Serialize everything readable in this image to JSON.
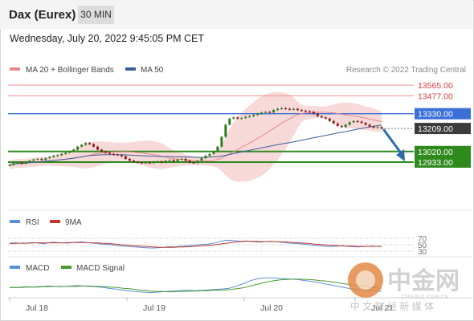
{
  "header": {
    "instrument": "Dax (Eurex)",
    "timeframe": "30 MIN",
    "datetime": "Wednesday, July 20, 2022 9:45:05 PM CET"
  },
  "colors": {
    "bb_band": "#f0b9b9",
    "ma20": "#e8888a",
    "ma50": "#3b5e9c",
    "resistance": "#f09090",
    "pivot": "#3a6fd8",
    "support": "#2f8a1d",
    "bull_candle": "#2e7d1a",
    "bear_candle": "#8b1a1a",
    "arrow": "#2e6ca8",
    "rsi": "#5b8fd8",
    "rsi_ma": "#c0392b",
    "macd": "#5b8fd8",
    "macd_signal": "#4a9a2b"
  },
  "chart_data": [
    {
      "type": "candlestick",
      "legend": {
        "ma20_label": "MA 20 + Bollinger Bands",
        "ma50_label": "MA 50",
        "credit": "Research © 2022 Trading Central"
      },
      "levels": [
        {
          "label": "13565.00",
          "value": 13565,
          "kind": "resistance"
        },
        {
          "label": "13477.00",
          "value": 13477,
          "kind": "resistance"
        },
        {
          "label": "13330.00",
          "value": 13330,
          "kind": "pivot"
        },
        {
          "label": "13209.00",
          "value": 13209,
          "kind": "last"
        },
        {
          "label": "13020.00",
          "value": 13020,
          "kind": "support"
        },
        {
          "label": "12933.00",
          "value": 12933,
          "kind": "support"
        }
      ],
      "x_labels": [
        "Jul 18",
        "Jul 19",
        "Jul 20",
        "Jul 21"
      ],
      "closes": [
        12910,
        12925,
        12930,
        12920,
        12935,
        12945,
        12955,
        12960,
        12950,
        12965,
        12975,
        12985,
        12990,
        13000,
        13010,
        13020,
        13035,
        13060,
        13075,
        13090,
        13080,
        13060,
        13035,
        13020,
        13010,
        13000,
        12995,
        12990,
        12980,
        12960,
        12945,
        12935,
        12930,
        12925,
        12930,
        12925,
        12935,
        12940,
        12930,
        12945,
        12950,
        12940,
        12955,
        12960,
        12945,
        12930,
        12925,
        12945,
        12965,
        12985,
        13000,
        13020,
        13060,
        13140,
        13240,
        13290,
        13300,
        13290,
        13295,
        13305,
        13310,
        13320,
        13330,
        13340,
        13345,
        13340,
        13360,
        13370,
        13375,
        13370,
        13365,
        13370,
        13360,
        13355,
        13350,
        13345,
        13330,
        13310,
        13300,
        13290,
        13270,
        13250,
        13230,
        13220,
        13240,
        13260,
        13270,
        13265,
        13255,
        13240,
        13225,
        13215,
        13220,
        13209
      ]
    },
    {
      "type": "line",
      "legend": {
        "rsi_label": "RSI",
        "rsi_ma_label": "9MA"
      },
      "ticks": [
        "70",
        "50",
        "30"
      ],
      "rsi": [
        55,
        56,
        55,
        54,
        56,
        57,
        55,
        53,
        56,
        58,
        57,
        56,
        55,
        57,
        58,
        59,
        57,
        55,
        54,
        52,
        51,
        50,
        48,
        46,
        45,
        44,
        43,
        42,
        41,
        40,
        40,
        41,
        42,
        44,
        43,
        45,
        46,
        47,
        48,
        50,
        51,
        52,
        54,
        58,
        62,
        64,
        63,
        62,
        61,
        62,
        60,
        59,
        58,
        60,
        61,
        60,
        58,
        57,
        55,
        54,
        53,
        52,
        50,
        48,
        47,
        46,
        44,
        45,
        46,
        47,
        45,
        44,
        43,
        44,
        45,
        46,
        45,
        44
      ],
      "rsi_ma": [
        54,
        54,
        55,
        55,
        55,
        56,
        56,
        56,
        56,
        56,
        56,
        56,
        57,
        57,
        57,
        57,
        57,
        56,
        56,
        55,
        54,
        53,
        52,
        50,
        49,
        48,
        47,
        46,
        45,
        44,
        43,
        42,
        42,
        42,
        42,
        43,
        43,
        44,
        45,
        46,
        47,
        48,
        49,
        51,
        53,
        55,
        57,
        59,
        60,
        61,
        61,
        61,
        60,
        60,
        60,
        60,
        59,
        59,
        58,
        57,
        56,
        55,
        54,
        52,
        51,
        50,
        49,
        48,
        47,
        47,
        46,
        46,
        45,
        45,
        45,
        45,
        45,
        45
      ]
    },
    {
      "type": "line",
      "legend": {
        "macd_label": "MACD",
        "signal_label": "MACD Signal"
      },
      "macd": [
        4,
        4,
        5,
        6,
        5,
        6,
        7,
        8,
        7,
        6,
        7,
        8,
        9,
        8,
        7,
        6,
        5,
        3,
        1,
        -1,
        -3,
        -5,
        -7,
        -8,
        -9,
        -10,
        -9,
        -8,
        -7,
        -6,
        -5,
        -4,
        -4,
        -5,
        -4,
        -3,
        -2,
        -1,
        0,
        2,
        6,
        12,
        18,
        24,
        28,
        30,
        31,
        30,
        29,
        28,
        27,
        26,
        24,
        22,
        20,
        17,
        14,
        11,
        8,
        5,
        2,
        0,
        -2,
        -3,
        -4,
        -5,
        -6
      ],
      "signal": [
        4,
        4,
        4,
        5,
        5,
        5,
        6,
        6,
        7,
        7,
        7,
        7,
        7,
        8,
        8,
        7,
        7,
        6,
        5,
        4,
        2,
        1,
        -1,
        -3,
        -4,
        -6,
        -7,
        -7,
        -8,
        -8,
        -7,
        -7,
        -6,
        -6,
        -5,
        -5,
        -4,
        -3,
        -3,
        -2,
        0,
        2,
        5,
        9,
        13,
        17,
        20,
        23,
        25,
        26,
        27,
        27,
        27,
        26,
        25,
        23,
        22,
        20,
        18,
        15,
        13,
        11,
        9,
        7,
        5,
        3,
        2
      ]
    }
  ],
  "watermark": {
    "brand": "中金网",
    "url": "CNGOLD.COM.CN",
    "slogan": "中 文 财 经 新 媒 体"
  }
}
